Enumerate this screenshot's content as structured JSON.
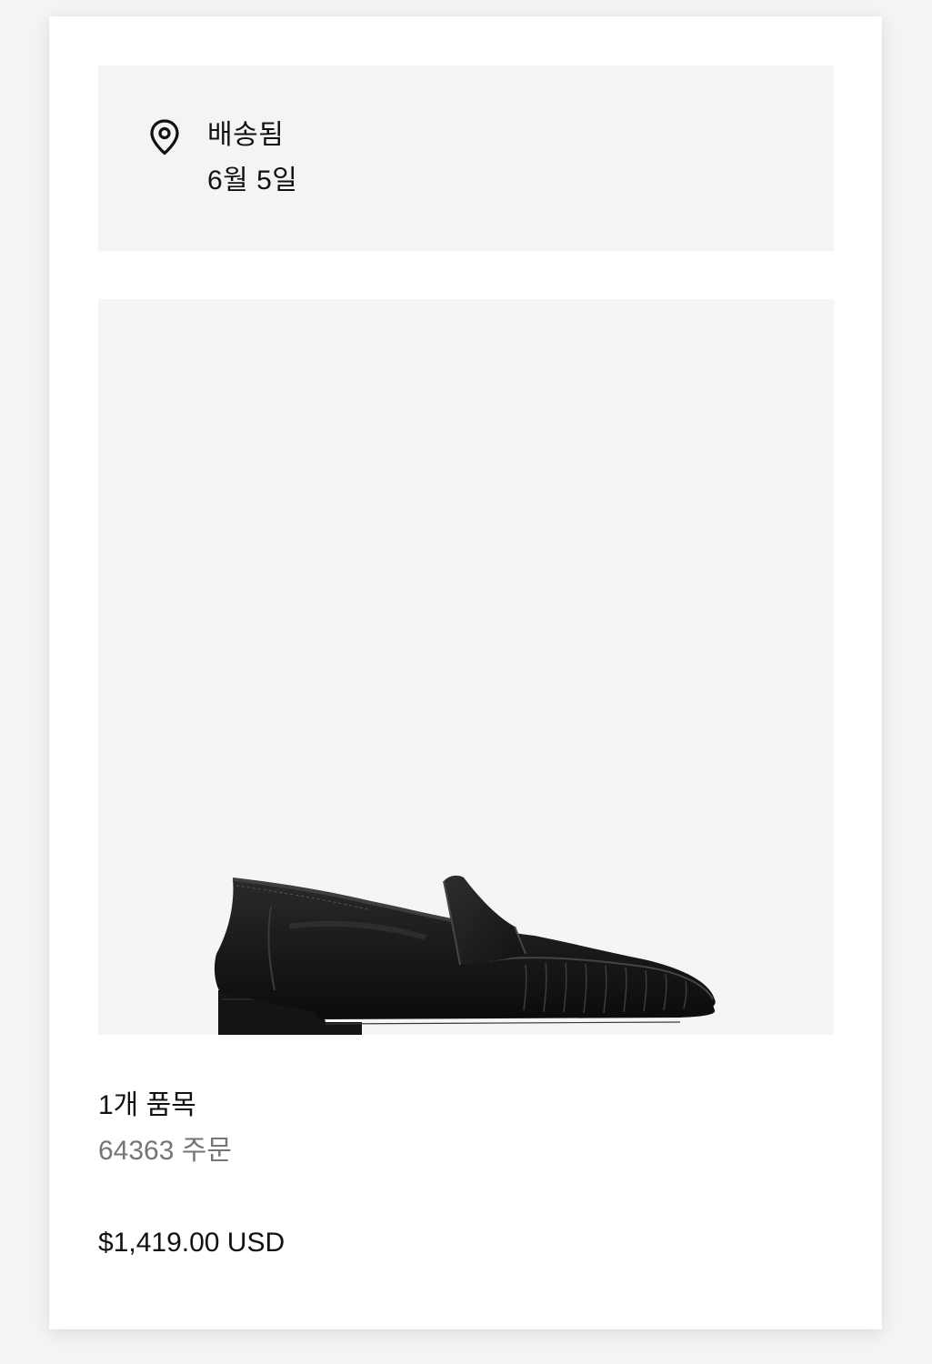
{
  "delivery": {
    "icon": "location-pin-icon",
    "status": "배송됨",
    "date": "6월 5일"
  },
  "product": {
    "image_icon": "loafer-shoe-icon",
    "image_background": "#f6f5f3"
  },
  "order": {
    "item_count": "1개 품목",
    "order_number": "64363 주문",
    "total": "$1,419.00 USD"
  },
  "colors": {
    "text_primary": "#111111",
    "text_secondary": "#757575",
    "panel_background": "#f4f4f4"
  }
}
